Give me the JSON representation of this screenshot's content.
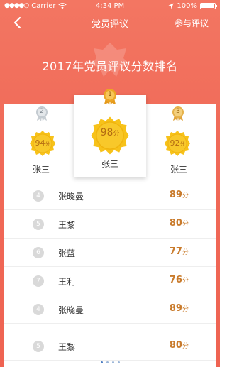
{
  "status_bar": {
    "signal": "●●●●○",
    "carrier": "Carrier",
    "time": "4:34 PM",
    "battery": "100%"
  },
  "nav": {
    "title": "党员评议",
    "action": "参与评议"
  },
  "headline": "2017年党员评议分数排名",
  "podium": {
    "first": {
      "rank": "1",
      "score": "98",
      "unit": "分",
      "name": "张三"
    },
    "second": {
      "rank": "2",
      "score": "94",
      "unit": "分",
      "name": "张三"
    },
    "third": {
      "rank": "3",
      "score": "92",
      "unit": "分",
      "name": "张三"
    }
  },
  "rows": [
    {
      "rank": "4",
      "name": "张晓曼",
      "score": "89",
      "unit": "分"
    },
    {
      "rank": "5",
      "name": "王黎",
      "score": "80",
      "unit": "分"
    },
    {
      "rank": "6",
      "name": "张蓝",
      "score": "77",
      "unit": "分"
    },
    {
      "rank": "7",
      "name": "王利",
      "score": "76",
      "unit": "分"
    },
    {
      "rank": "4",
      "name": "张晓曼",
      "score": "89",
      "unit": "分"
    },
    {
      "rank": "5",
      "name": "王黎",
      "score": "80",
      "unit": "分"
    }
  ],
  "colors": {
    "header_bg": "#f06a58",
    "gold": "#f7c21a",
    "score_text": "#c97b2c",
    "silver_medal": "#b9c0c6",
    "bronze_medal": "#e2b04a",
    "gold_medal": "#e9a31f"
  }
}
